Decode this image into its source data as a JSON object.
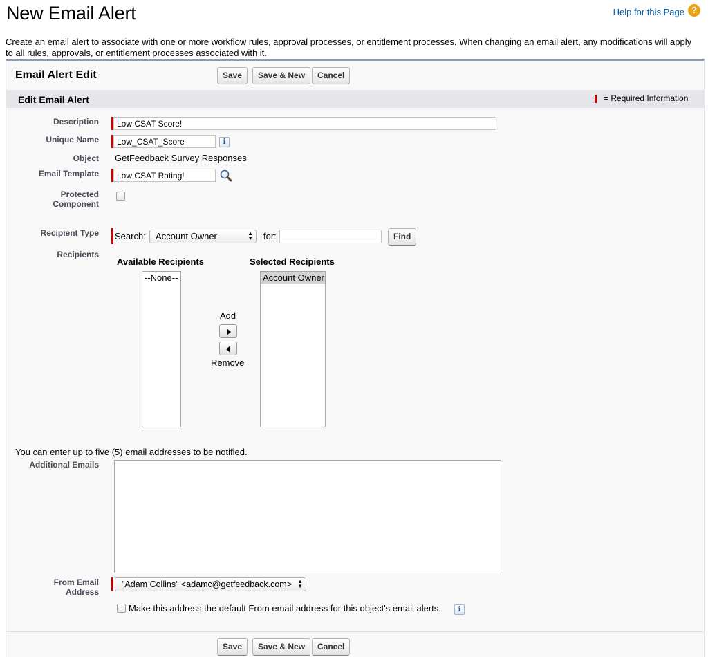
{
  "page": {
    "title": "New Email Alert",
    "help_link": "Help for this Page",
    "help_icon": "?",
    "intro": "Create an email alert to associate with one or more workflow rules, approval processes, or entitlement processes. When changing an email alert, any modifications will apply to all rules, approvals, or entitlement processes associated with it."
  },
  "block": {
    "title": "Email Alert Edit",
    "buttons": {
      "save": "Save",
      "save_new": "Save & New",
      "cancel": "Cancel"
    }
  },
  "section": {
    "title": "Edit Email Alert",
    "required_legend": "= Required Information"
  },
  "fields": {
    "description": {
      "label": "Description",
      "value": "Low CSAT Score!"
    },
    "unique_name": {
      "label": "Unique Name",
      "value": "Low_CSAT_Score",
      "info": "i"
    },
    "object": {
      "label": "Object",
      "value": "GetFeedback Survey Responses"
    },
    "email_template": {
      "label": "Email Template",
      "value": "Low CSAT Rating!"
    },
    "protected_component": {
      "label_line1": "Protected",
      "label_line2": "Component",
      "checked": false
    },
    "recipient_type": {
      "label": "Recipient Type",
      "search_label": "Search:",
      "selected": "Account Owner",
      "for_label": "for:",
      "for_value": "",
      "find_button": "Find"
    },
    "recipients": {
      "label": "Recipients",
      "available_header": "Available Recipients",
      "selected_header": "Selected Recipients",
      "available": [
        "--None--"
      ],
      "selected": [
        "Account Owner"
      ],
      "add_label": "Add",
      "remove_label": "Remove"
    },
    "additional_emails": {
      "note": "You can enter up to five (5) email addresses to be notified.",
      "label": "Additional Emails",
      "value": ""
    },
    "from_email": {
      "label_line1": "From Email",
      "label_line2": "Address",
      "selected": "\"Adam Collins\" <adamc@getfeedback.com>",
      "default_checkbox_label": "Make this address the default From email address for this object's email alerts.",
      "info": "i"
    }
  },
  "colors": {
    "required": "#cc0000",
    "panel_border": "#8c9aaf",
    "section_header": "#e3e5e8",
    "link": "#015ba7",
    "help_icon": "#e8a317"
  }
}
